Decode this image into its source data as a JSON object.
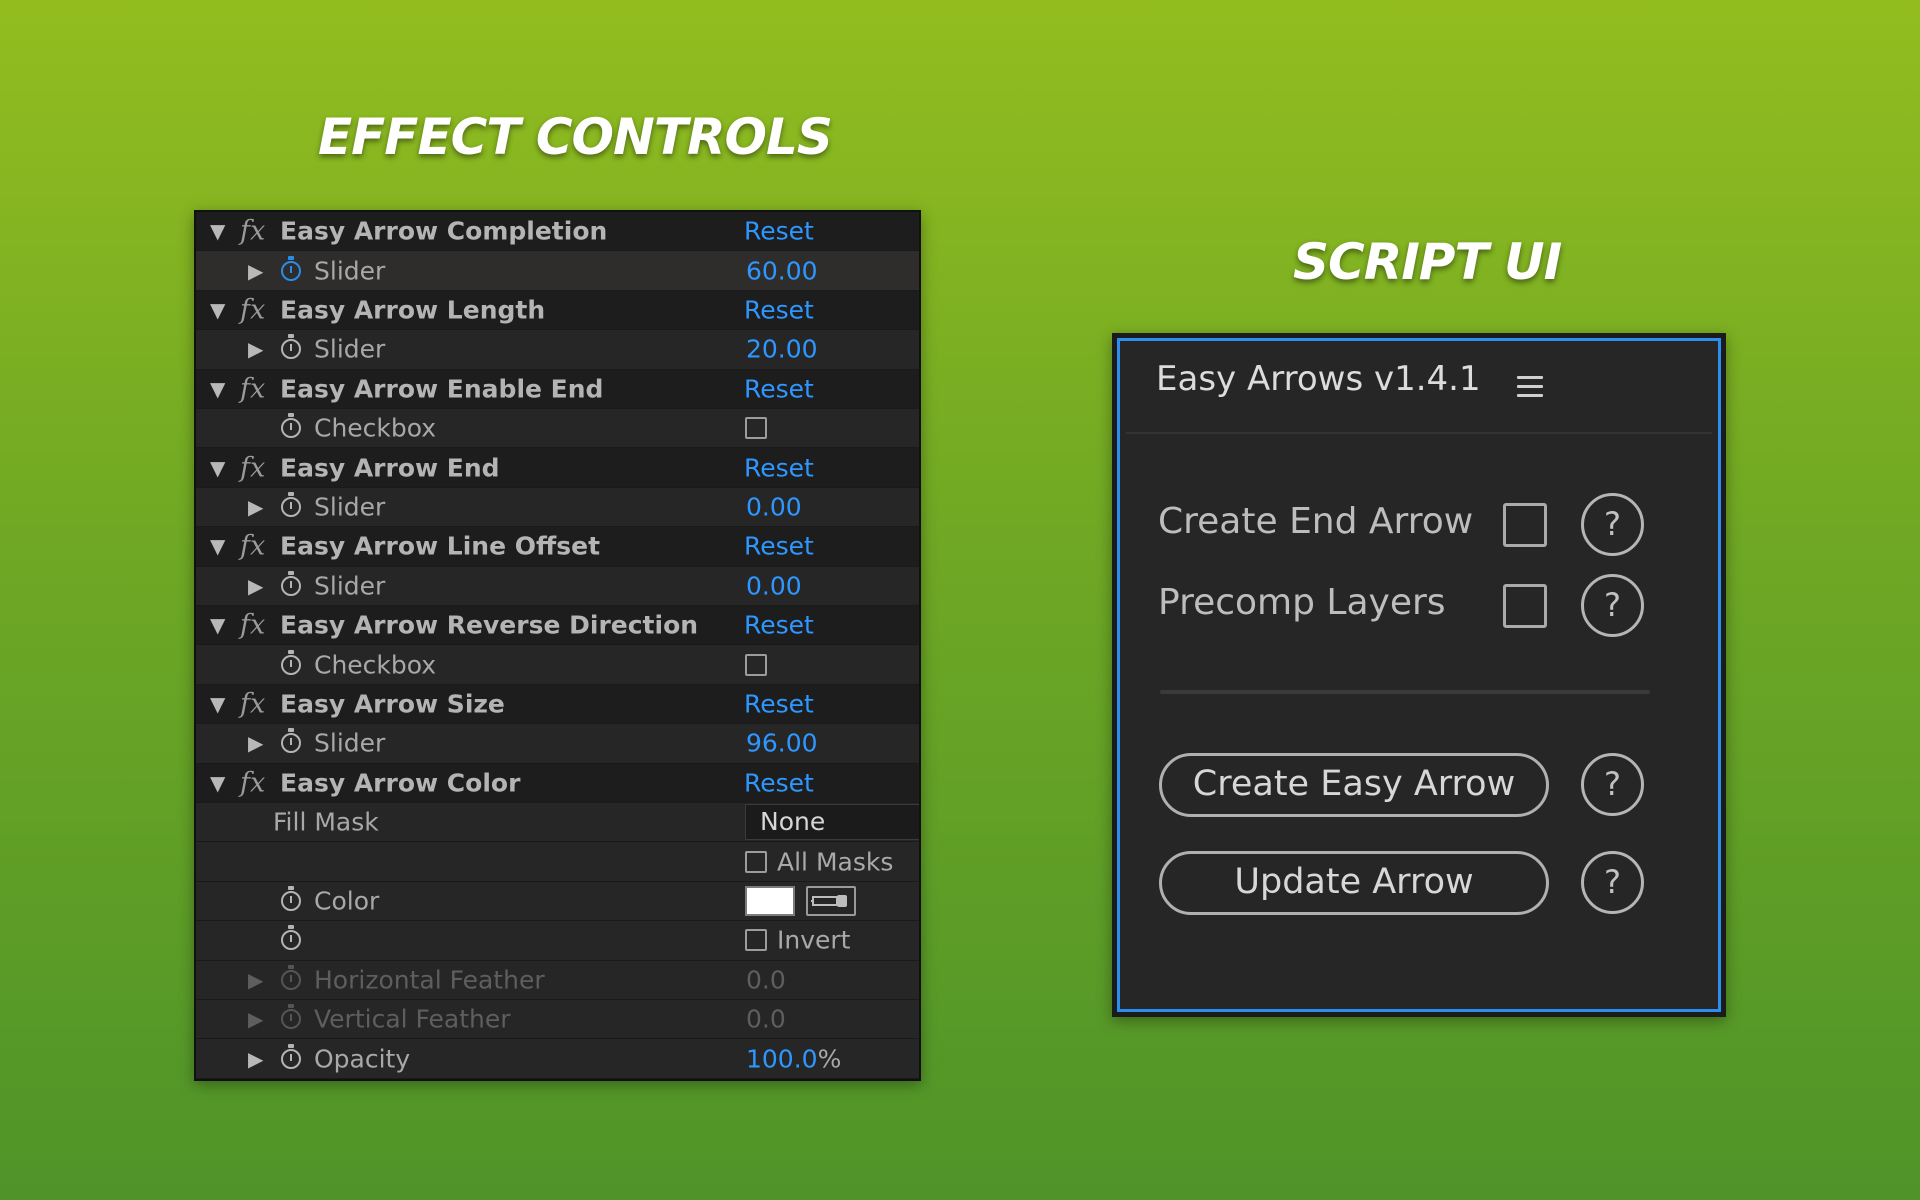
{
  "headings": {
    "effect_controls": "EFFECT CONTROLS",
    "script_ui": "SCRIPT UI"
  },
  "effects": [
    {
      "name": "Easy Arrow Completion",
      "reset": "Reset",
      "property": "Slider",
      "value": "60.00"
    },
    {
      "name": "Easy Arrow Length",
      "reset": "Reset",
      "property": "Slider",
      "value": "20.00"
    },
    {
      "name": "Easy Arrow Enable End",
      "reset": "Reset",
      "property": "Checkbox"
    },
    {
      "name": "Easy Arrow End",
      "reset": "Reset",
      "property": "Slider",
      "value": "0.00"
    },
    {
      "name": "Easy Arrow Line Offset",
      "reset": "Reset",
      "property": "Slider",
      "value": "0.00"
    },
    {
      "name": "Easy Arrow Reverse Direction",
      "reset": "Reset",
      "property": "Checkbox"
    },
    {
      "name": "Easy Arrow Size",
      "reset": "Reset",
      "property": "Slider",
      "value": "96.00"
    },
    {
      "name": "Easy Arrow Color",
      "reset": "Reset",
      "fill_mask_label": "Fill Mask",
      "fill_mask_value": "None",
      "all_masks_label": "All Masks",
      "color_label": "Color",
      "color_value": "#ffffff",
      "invert_label": "Invert",
      "horizontal_feather_label": "Horizontal Feather",
      "horizontal_feather_value": "0.0",
      "vertical_feather_label": "Vertical Feather",
      "vertical_feather_value": "0.0",
      "opacity_label": "Opacity",
      "opacity_value": "100.0",
      "opacity_unit": "%"
    }
  ],
  "script_ui": {
    "title": "Easy Arrows v1.4.1",
    "menu_icon": "hamburger-menu-icon",
    "options": [
      {
        "label": "Create End Arrow",
        "checked": false,
        "help": "?"
      },
      {
        "label": "Precomp Layers",
        "checked": false,
        "help": "?"
      }
    ],
    "buttons": [
      {
        "label": "Create Easy Arrow",
        "help": "?"
      },
      {
        "label": "Update Arrow",
        "help": "?"
      }
    ]
  },
  "colors": {
    "accent_blue": "#2e97ff",
    "panel_border_blue": "#2c8eef",
    "background_green": "#6fa824"
  }
}
